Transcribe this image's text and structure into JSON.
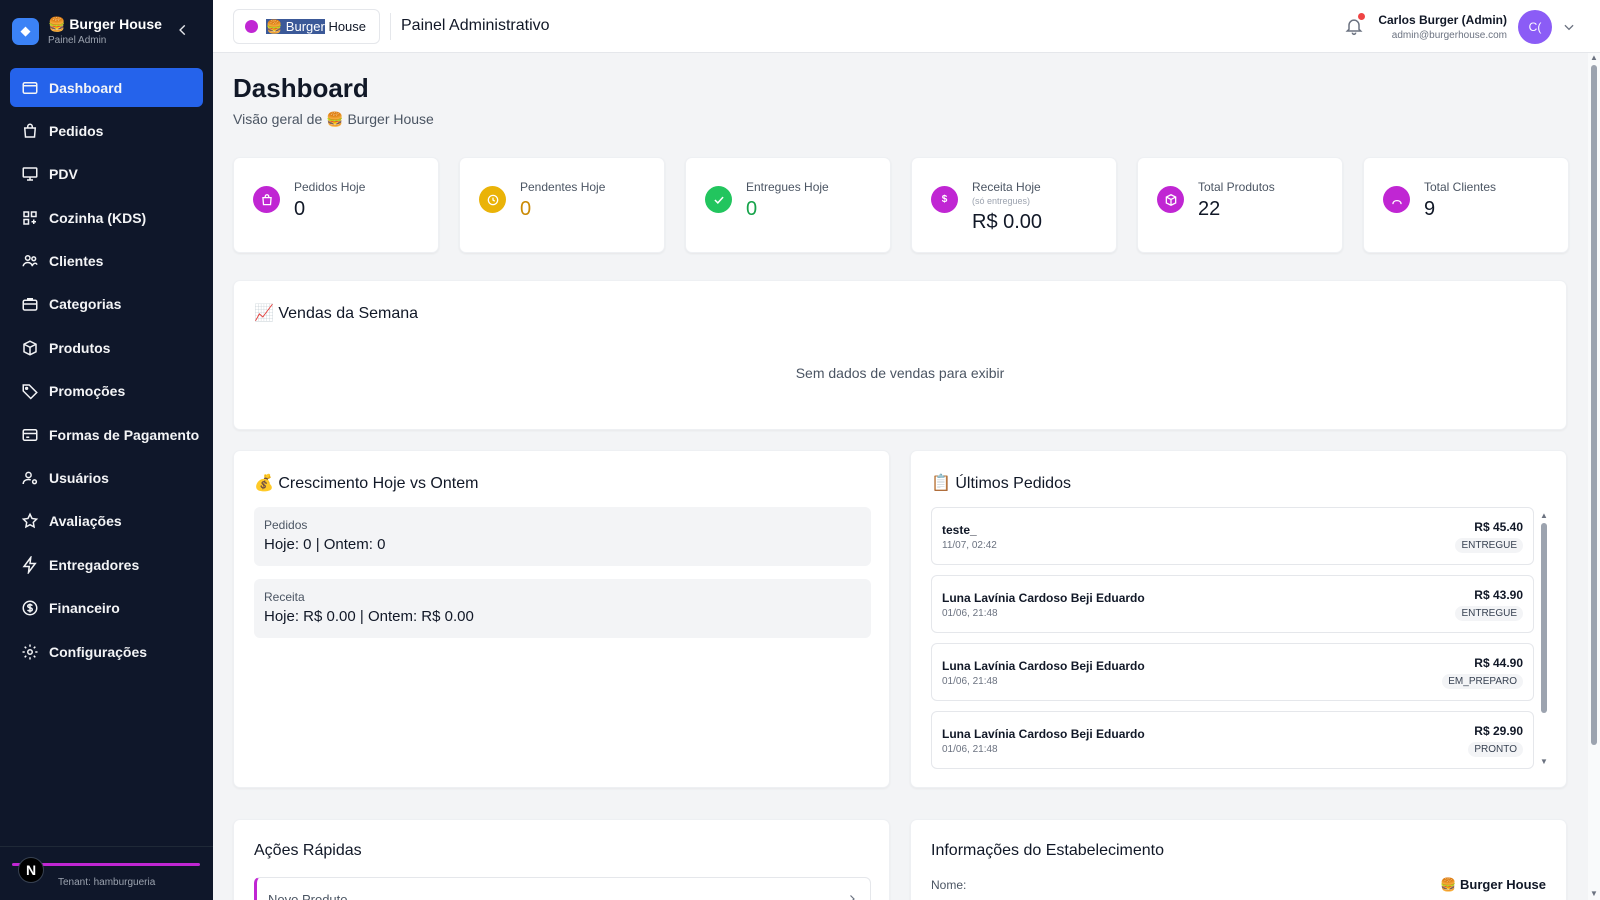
{
  "sidebar": {
    "brand_name": "🍔 Burger House",
    "brand_sub": "Painel Admin",
    "items": [
      {
        "label": "Dashboard",
        "icon": "folder-icon",
        "active": true
      },
      {
        "label": "Pedidos",
        "icon": "shopping-bag-icon"
      },
      {
        "label": "PDV",
        "icon": "monitor-icon"
      },
      {
        "label": "Cozinha (KDS)",
        "icon": "grid-icon"
      },
      {
        "label": "Clientes",
        "icon": "users-icon"
      },
      {
        "label": "Categorias",
        "icon": "briefcase-icon"
      },
      {
        "label": "Produtos",
        "icon": "box-icon"
      },
      {
        "label": "Promoções",
        "icon": "tag-icon"
      },
      {
        "label": "Formas de Pagamento",
        "icon": "credit-card-icon"
      },
      {
        "label": "Usuários",
        "icon": "user-cog-icon"
      },
      {
        "label": "Avaliações",
        "icon": "star-icon"
      },
      {
        "label": "Entregadores",
        "icon": "bolt-icon"
      },
      {
        "label": "Financeiro",
        "icon": "dollar-icon"
      },
      {
        "label": "Configurações",
        "icon": "gear-icon"
      }
    ],
    "footer_initial": "N",
    "tenant": "Tenant: hamburgueria"
  },
  "header": {
    "brand_highlight": "🍔 Burger",
    "brand_rest": " House",
    "title": "Painel Administrativo",
    "user_name": "Carlos Burger (Admin)",
    "user_email": "admin@burgerhouse.com",
    "avatar_initials": "C("
  },
  "page": {
    "title": "Dashboard",
    "subtitle": "Visão geral de 🍔 Burger House"
  },
  "stats": [
    {
      "label": "Pedidos Hoje",
      "value": "0",
      "color": "#c026d3",
      "value_color": "#111827",
      "icon": "shopping-bag-icon"
    },
    {
      "label": "Pendentes Hoje",
      "value": "0",
      "color": "#eab308",
      "value_color": "#ca8a04",
      "icon": "clock-icon"
    },
    {
      "label": "Entregues Hoje",
      "value": "0",
      "color": "#22c55e",
      "value_color": "#16a34a",
      "icon": "check-icon"
    },
    {
      "label": "Receita Hoje",
      "note": "(só entregues)",
      "value": "R$ 0.00",
      "color": "#c026d3",
      "value_color": "#111827",
      "icon": "dollar-icon"
    },
    {
      "label": "Total Produtos",
      "value": "22",
      "color": "#c026d3",
      "value_color": "#111827",
      "icon": "box-icon"
    },
    {
      "label": "Total Clientes",
      "value": "9",
      "color": "#c026d3",
      "value_color": "#111827",
      "icon": "users-icon"
    }
  ],
  "sales": {
    "title": "📈 Vendas da Semana",
    "empty": "Sem dados de vendas para exibir"
  },
  "growth": {
    "title": "💰 Crescimento Hoje vs Ontem",
    "rows": [
      {
        "label": "Pedidos",
        "value": "Hoje: 0 | Ontem: 0"
      },
      {
        "label": "Receita",
        "value": "Hoje: R$ 0.00 | Ontem: R$ 0.00"
      }
    ]
  },
  "orders": {
    "title": "📋 Últimos Pedidos",
    "items": [
      {
        "name": "teste_",
        "time": "11/07, 02:42",
        "price": "R$ 45.40",
        "status": "ENTREGUE"
      },
      {
        "name": "Luna Lavínia Cardoso Beji Eduardo",
        "time": "01/06, 21:48",
        "price": "R$ 43.90",
        "status": "ENTREGUE"
      },
      {
        "name": "Luna Lavínia Cardoso Beji Eduardo",
        "time": "01/06, 21:48",
        "price": "R$ 44.90",
        "status": "EM_PREPARO"
      },
      {
        "name": "Luna Lavínia Cardoso Beji Eduardo",
        "time": "01/06, 21:48",
        "price": "R$ 29.90",
        "status": "PRONTO"
      }
    ]
  },
  "quick": {
    "title": "Ações Rápidas",
    "first_item": "Novo Produto"
  },
  "info": {
    "title": "Informações do Estabelecimento",
    "name_label": "Nome:",
    "name_value": "🍔 Burger House"
  }
}
